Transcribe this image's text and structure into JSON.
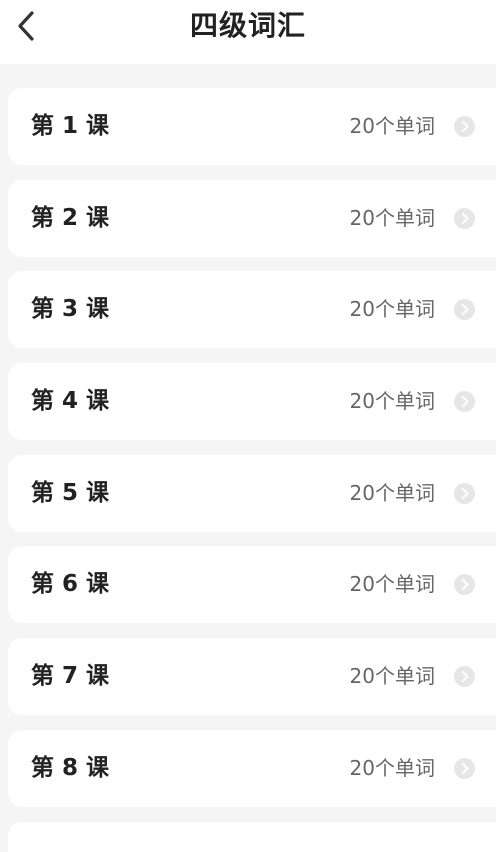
{
  "header": {
    "title": "四级词汇",
    "back_icon": "chevron-left-icon"
  },
  "lessons": [
    {
      "title": "第 1 课",
      "count": "20个单词"
    },
    {
      "title": "第 2 课",
      "count": "20个单词"
    },
    {
      "title": "第 3 课",
      "count": "20个单词"
    },
    {
      "title": "第 4 课",
      "count": "20个单词"
    },
    {
      "title": "第 5 课",
      "count": "20个单词"
    },
    {
      "title": "第 6 课",
      "count": "20个单词"
    },
    {
      "title": "第 7 课",
      "count": "20个单词"
    },
    {
      "title": "第 8 课",
      "count": "20个单词"
    }
  ],
  "item_icon": "chevron-right-circle-icon",
  "colors": {
    "background": "#f5f5f5",
    "card": "#ffffff",
    "title_text": "#222222",
    "count_text": "#666666",
    "chevron_bg": "#e6e6e6"
  }
}
